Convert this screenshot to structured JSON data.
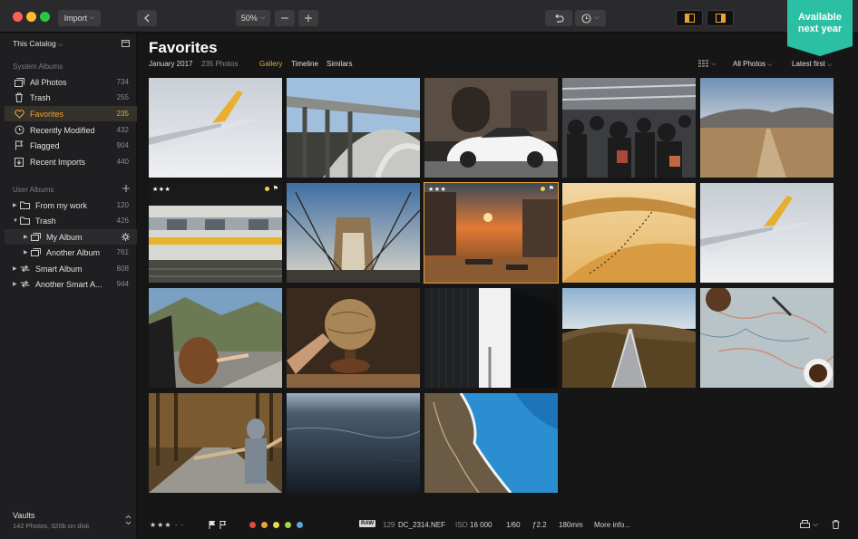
{
  "toolbar": {
    "import_label": "Import",
    "zoom_label": "50%",
    "ribbon_line1": "Available",
    "ribbon_line2": "next year"
  },
  "colors": {
    "accent": "#e8a23a",
    "ribbon": "#2bc0a3",
    "close": "#fd5f57",
    "minimize": "#febc2e",
    "maximize": "#28c840"
  },
  "sidebar": {
    "catalog_label": "This Catalog",
    "system_section": "System Albums",
    "system_items": [
      {
        "label": "All Photos",
        "count": "734",
        "icon": "photos-icon"
      },
      {
        "label": "Trash",
        "count": "255",
        "icon": "trash-icon"
      },
      {
        "label": "Favorites",
        "count": "235",
        "icon": "heart-icon"
      },
      {
        "label": "Recently Modified",
        "count": "432",
        "icon": "clock-icon"
      },
      {
        "label": "Flagged",
        "count": "904",
        "icon": "flag-icon"
      },
      {
        "label": "Recent Imports",
        "count": "440",
        "icon": "import-icon"
      }
    ],
    "user_section": "User Albums",
    "user_items": [
      {
        "label": "From my work",
        "count": "120",
        "icon": "folder-icon"
      },
      {
        "label": "Trash",
        "count": "426",
        "icon": "folder-icon"
      },
      {
        "label": "My Album",
        "count": "",
        "icon": "album-icon"
      },
      {
        "label": "Another Album",
        "count": "761",
        "icon": "album-icon"
      },
      {
        "label": "Smart Album",
        "count": "808",
        "icon": "smart-album-icon"
      },
      {
        "label": "Another Smart A...",
        "count": "944",
        "icon": "smart-album-icon"
      }
    ],
    "vaults_label": "Vaults",
    "vaults_sub": "142 Photos, 320b on disk"
  },
  "main": {
    "title": "Favorites",
    "date": "January 2017",
    "photo_count": "235 Photos",
    "tabs": [
      "Gallery",
      "Timeline",
      "Similars"
    ],
    "filter_label": "All Photos",
    "sort_label": "Latest first"
  },
  "photos": [
    {
      "name": "Airplane wing over clouds"
    },
    {
      "name": "Bridge"
    },
    {
      "name": "White car"
    },
    {
      "name": "Crowd at station"
    },
    {
      "name": "Desert road"
    },
    {
      "name": "Yellow train",
      "stars": "★★★"
    },
    {
      "name": "Brooklyn Bridge"
    },
    {
      "name": "Sunset canal",
      "stars": "★★★"
    },
    {
      "name": "Sand dunes"
    },
    {
      "name": "Airplane wing"
    },
    {
      "name": "Car window hair"
    },
    {
      "name": "Globe"
    },
    {
      "name": "Buildings"
    },
    {
      "name": "Suspension walkway"
    },
    {
      "name": "Map and coffee"
    },
    {
      "name": "Forest road"
    },
    {
      "name": "Ocean"
    },
    {
      "name": "Coastline aerial"
    }
  ],
  "bottom": {
    "stars": "★★★ · ·",
    "raw": "RAW",
    "file_index": "129",
    "file_name": "DC_2314.NEF",
    "iso_label": "ISO",
    "iso_value": "16 000",
    "shutter": "1/60",
    "aperture": "ƒ2.2",
    "focal": "180mm",
    "more": "More info...",
    "label_colors": [
      "#e8474a",
      "#e8a23a",
      "#e8d84a",
      "#a6d64a",
      "#5aa6e0"
    ]
  }
}
